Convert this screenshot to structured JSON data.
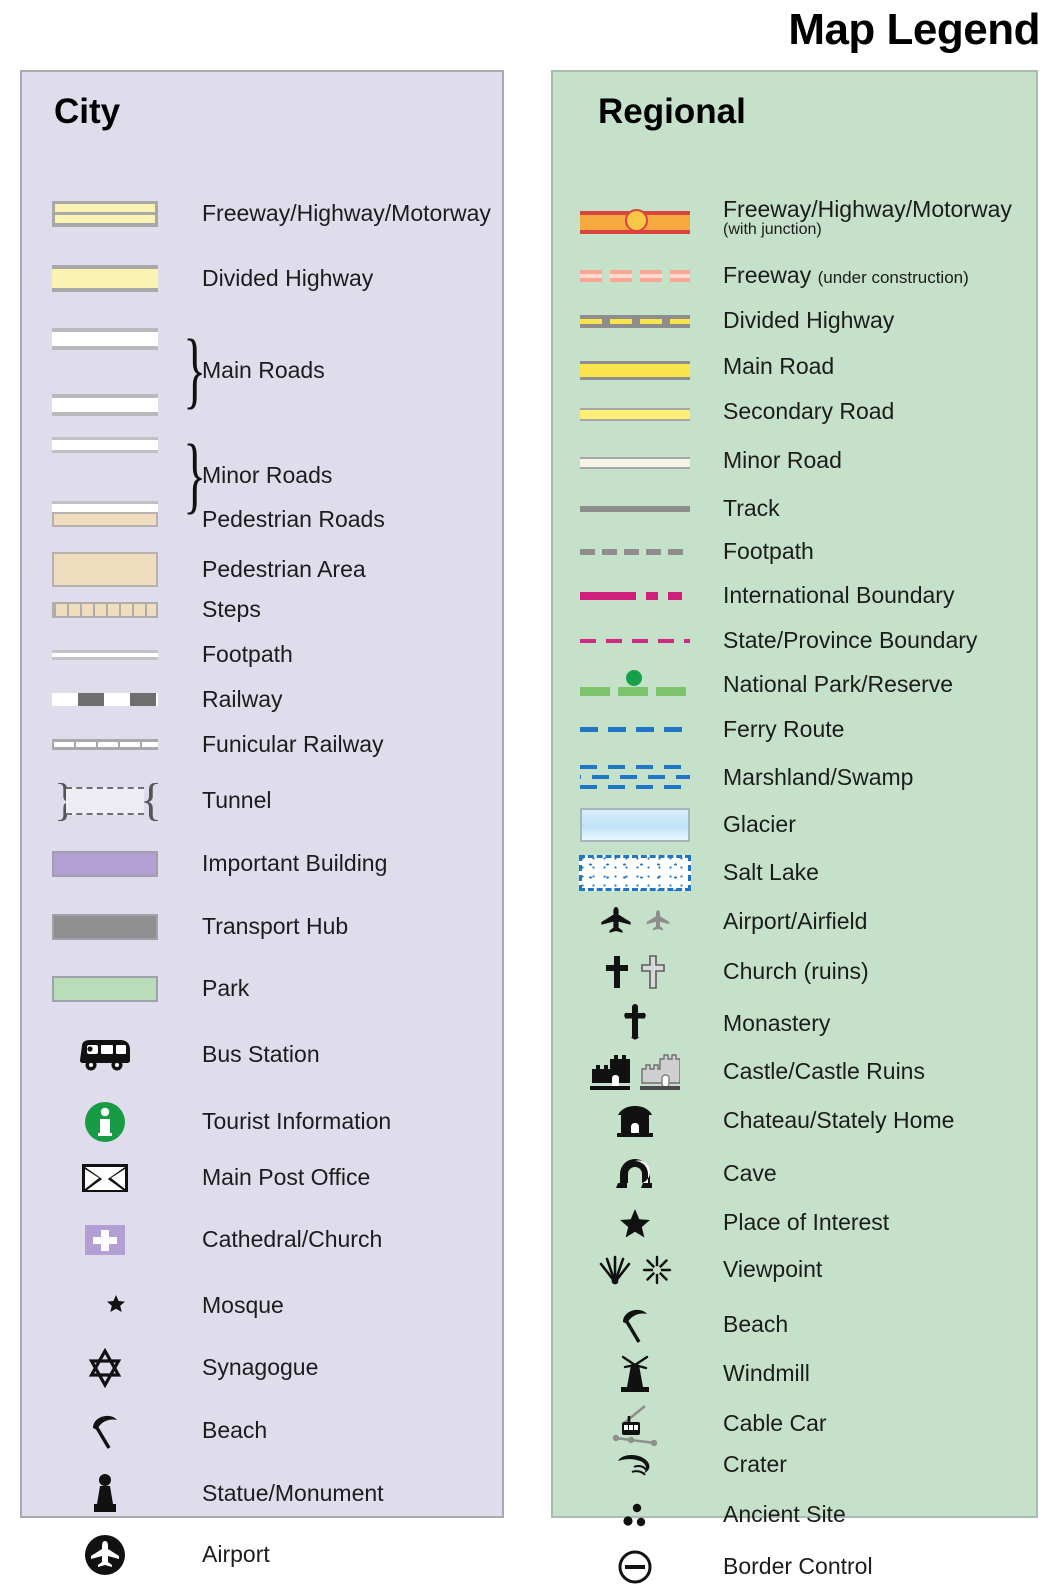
{
  "title": "Map Legend",
  "city": {
    "heading": "City",
    "items": [
      {
        "label": "Freeway/Highway/Motorway",
        "icon": "freeway-swatch"
      },
      {
        "label": "Divided Highway",
        "icon": "divided-highway-swatch"
      },
      {
        "label": "Main Roads",
        "icon": "main-roads-swatch"
      },
      {
        "label": "Minor Roads",
        "icon": "minor-roads-swatch"
      },
      {
        "label": "Pedestrian Roads",
        "icon": "pedestrian-road-swatch"
      },
      {
        "label": "Pedestrian Area",
        "icon": "pedestrian-area-swatch"
      },
      {
        "label": "Steps",
        "icon": "steps-swatch"
      },
      {
        "label": "Footpath",
        "icon": "footpath-swatch"
      },
      {
        "label": "Railway",
        "icon": "railway-swatch"
      },
      {
        "label": "Funicular Railway",
        "icon": "funicular-railway-swatch"
      },
      {
        "label": "Tunnel",
        "icon": "tunnel-swatch"
      },
      {
        "label": "Important Building",
        "icon": "important-building-swatch"
      },
      {
        "label": "Transport Hub",
        "icon": "transport-hub-swatch"
      },
      {
        "label": "Park",
        "icon": "park-swatch"
      },
      {
        "label": "Bus Station",
        "icon": "bus-icon"
      },
      {
        "label": "Tourist Information",
        "icon": "information-icon"
      },
      {
        "label": "Main Post Office",
        "icon": "envelope-icon"
      },
      {
        "label": "Cathedral/Church",
        "icon": "cross-square-icon"
      },
      {
        "label": "Mosque",
        "icon": "crescent-star-icon"
      },
      {
        "label": "Synagogue",
        "icon": "star-of-david-icon"
      },
      {
        "label": "Beach",
        "icon": "beach-umbrella-icon"
      },
      {
        "label": "Statue/Monument",
        "icon": "statue-icon"
      },
      {
        "label": "Airport",
        "icon": "airport-circle-icon"
      }
    ]
  },
  "regional": {
    "heading": "Regional",
    "items": [
      {
        "label": "Freeway/Highway/Motorway",
        "sub": "(with junction)",
        "sub_block": true,
        "icon": "freeway-junction-line"
      },
      {
        "label": "Freeway",
        "sub": "(under construction)",
        "sub_block": false,
        "icon": "freeway-under-construction-line"
      },
      {
        "label": "Divided Highway",
        "icon": "divided-highway-line"
      },
      {
        "label": "Main Road",
        "icon": "main-road-line"
      },
      {
        "label": "Secondary Road",
        "icon": "secondary-road-line"
      },
      {
        "label": "Minor Road",
        "icon": "minor-road-line"
      },
      {
        "label": "Track",
        "icon": "track-line"
      },
      {
        "label": "Footpath",
        "icon": "footpath-line"
      },
      {
        "label": "International Boundary",
        "icon": "international-boundary-line"
      },
      {
        "label": "State/Province Boundary",
        "icon": "state-boundary-line"
      },
      {
        "label": "National Park/Reserve",
        "icon": "national-park-line"
      },
      {
        "label": "Ferry Route",
        "icon": "ferry-route-line"
      },
      {
        "label": "Marshland/Swamp",
        "icon": "marshland-pattern"
      },
      {
        "label": "Glacier",
        "icon": "glacier-swatch"
      },
      {
        "label": "Salt Lake",
        "icon": "salt-lake-swatch"
      },
      {
        "label": "Airport/Airfield",
        "icon": "airplane-pair-icon"
      },
      {
        "label": "Church (ruins)",
        "icon": "cross-pair-icon"
      },
      {
        "label": "Monastery",
        "icon": "orthodox-cross-icon"
      },
      {
        "label": "Castle/Castle Ruins",
        "icon": "castle-pair-icon"
      },
      {
        "label": "Chateau/Stately Home",
        "icon": "chateau-icon"
      },
      {
        "label": "Cave",
        "icon": "cave-icon"
      },
      {
        "label": "Place of Interest",
        "icon": "star-icon"
      },
      {
        "label": "Viewpoint",
        "icon": "viewpoint-pair-icon"
      },
      {
        "label": "Beach",
        "icon": "beach-umbrella-icon"
      },
      {
        "label": "Windmill",
        "icon": "windmill-icon"
      },
      {
        "label": "Cable Car",
        "icon": "cable-car-icon"
      },
      {
        "label": "Crater",
        "icon": "crater-icon"
      },
      {
        "label": "Ancient Site",
        "icon": "ancient-site-icon"
      },
      {
        "label": "Border Control",
        "icon": "border-control-icon"
      }
    ]
  },
  "colors": {
    "city_panel_bg": "#dfdcec",
    "regional_panel_bg": "#c6e1ca",
    "highway_yellow": "#fbf3b4",
    "freeway_red": "#d9443e",
    "freeway_orange": "#f5a93f",
    "boundary_magenta": "#cf1e7c",
    "park_green": "#7cc36b",
    "ferry_blue": "#1f76c4",
    "important_building_purple": "#b49fd4",
    "tourist_info_green": "#179b45"
  }
}
